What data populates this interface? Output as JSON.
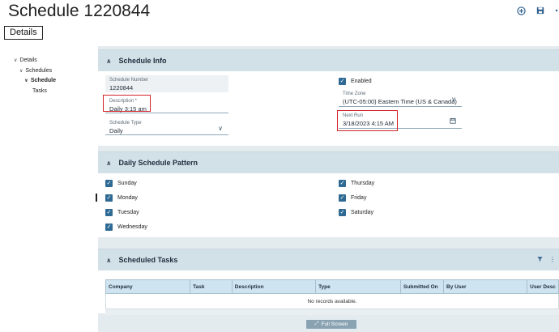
{
  "header": {
    "title": "Schedule 1220844",
    "icons": [
      "add-circle-icon",
      "save-icon",
      "more-icon"
    ]
  },
  "tab": {
    "label": "Details"
  },
  "tree": [
    {
      "label": "Details",
      "level": 0,
      "expanded": true
    },
    {
      "label": "Schedules",
      "level": 1,
      "expanded": true
    },
    {
      "label": "Schedule",
      "level": 2,
      "expanded": true,
      "selected": true
    },
    {
      "label": "Tasks",
      "level": 3,
      "expanded": false
    }
  ],
  "schedule_info": {
    "title": "Schedule Info",
    "schedule_number": {
      "label": "Schedule Number",
      "value": "1220844"
    },
    "description": {
      "label": "Description *",
      "value": "Daily 3:15 am"
    },
    "schedule_type": {
      "label": "Schedule Type",
      "value": "Daily"
    },
    "enabled": {
      "label": "Enabled",
      "checked": true
    },
    "time_zone": {
      "label": "Time Zone",
      "value": "(UTC-05:00) Eastern Time (US & Canada)"
    },
    "next_run": {
      "label": "Next Run",
      "value": "3/18/2023 4:15 AM"
    }
  },
  "pattern": {
    "title": "Daily Schedule Pattern",
    "days": [
      {
        "label": "Sunday",
        "checked": true
      },
      {
        "label": "Monday",
        "checked": true
      },
      {
        "label": "Tuesday",
        "checked": true
      },
      {
        "label": "Wednesday",
        "checked": true
      },
      {
        "label": "Thursday",
        "checked": true
      },
      {
        "label": "Friday",
        "checked": true
      },
      {
        "label": "Saturday",
        "checked": true
      }
    ]
  },
  "tasks": {
    "title": "Scheduled Tasks",
    "columns": [
      "Company",
      "Task",
      "Description",
      "Type",
      "Submitted On",
      "By User",
      "User Desc"
    ],
    "empty_message": "No records available.",
    "fullscreen_label": "Full Screen"
  },
  "colors": {
    "accent": "#2f6a94",
    "section_header": "#d2e0e7",
    "highlight": "#d2232a",
    "grid_header": "#cfe4f1"
  }
}
